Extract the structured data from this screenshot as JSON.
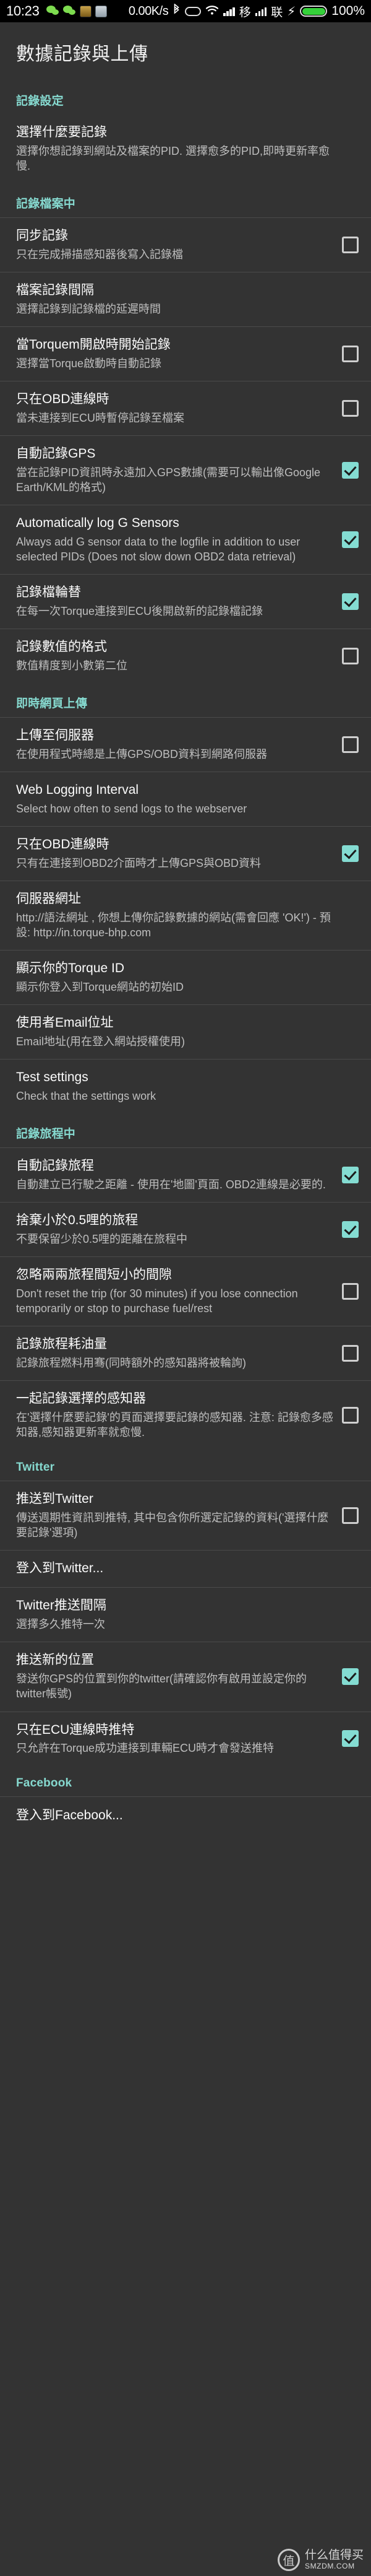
{
  "status_bar": {
    "time": "10:23",
    "net_speed": "0.00K/s",
    "mobile_label": "移",
    "carrier_label": "联",
    "battery_percent": "100%",
    "icons": [
      "wechat-icon",
      "wechat-icon",
      "app-icon",
      "app-icon",
      "bluetooth-icon",
      "vibrate-icon",
      "wifi-icon",
      "signal-bars-icon",
      "signal-bars-icon",
      "charging-bolt-icon",
      "battery-icon"
    ]
  },
  "page": {
    "title": "數據記錄與上傳"
  },
  "sections": [
    {
      "header": "記錄設定",
      "rows": [
        {
          "title": "選擇什麼要記錄",
          "summary": "選擇你想記錄到網站及檔案的PID. 選擇愈多的PID,即時更新率愈慢.",
          "checkbox": "none",
          "name": "row-select-what-to-log"
        }
      ]
    },
    {
      "header": "記錄檔案中",
      "rows": [
        {
          "title": "同步記錄",
          "summary": "只在完成掃描感知器後寫入記錄檔",
          "checkbox": "off",
          "name": "row-sync-logging"
        },
        {
          "title": "檔案記錄間隔",
          "summary": "選擇記錄到記錄檔的延遲時間",
          "checkbox": "none",
          "name": "row-file-logging-interval"
        },
        {
          "title": "當Torquem開啟時開始記錄",
          "summary": "選擇當Torque啟動時自動記錄",
          "checkbox": "off",
          "name": "row-start-logging-on-launch"
        },
        {
          "title": "只在OBD連線時",
          "summary": "當未連接到ECU時暫停記錄至檔案",
          "checkbox": "off",
          "name": "row-only-when-obd-connected-file"
        },
        {
          "title": "自動記錄GPS",
          "summary": "當在記錄PID資訊時永遠加入GPS數據(需要可以輸出像Google Earth/KML的格式)",
          "checkbox": "on",
          "name": "row-auto-log-gps"
        },
        {
          "title": "Automatically log G Sensors",
          "summary": "Always add G sensor data to the logfile in addition to user selected PIDs (Does not slow down OBD2 data retrieval)",
          "checkbox": "on",
          "name": "row-auto-log-g-sensors"
        },
        {
          "title": "記錄檔輪替",
          "summary": "在每一次Torque連接到ECU後開啟新的記錄檔記錄",
          "checkbox": "on",
          "name": "row-logfile-rotation"
        },
        {
          "title": "記錄數值的格式",
          "summary": "數值精度到小數第二位",
          "checkbox": "off",
          "name": "row-log-value-format"
        }
      ]
    },
    {
      "header": "即時網頁上傳",
      "rows": [
        {
          "title": "上傳至伺服器",
          "summary": "在使用程式時總是上傳GPS/OBD資料到網路伺服器",
          "checkbox": "off",
          "name": "row-upload-to-server"
        },
        {
          "title": "Web Logging Interval",
          "summary": "Select how often to send logs to the webserver",
          "checkbox": "none",
          "name": "row-web-logging-interval"
        },
        {
          "title": "只在OBD連線時",
          "summary": "只有在連接到OBD2介面時才上傳GPS與OBD資料",
          "checkbox": "on",
          "name": "row-only-when-obd-connected-web"
        },
        {
          "title": "伺服器網址",
          "summary": "http://語法網址 , 你想上傳你記錄數據的網站(需會回應 'OK!') - 預設: http://in.torque-bhp.com",
          "checkbox": "none",
          "name": "row-server-url"
        },
        {
          "title": "顯示你的Torque ID",
          "summary": "顯示你登入到Torque網站的初始ID",
          "checkbox": "none",
          "name": "row-show-torque-id"
        },
        {
          "title": "使用者Email位址",
          "summary": "Email地址(用在登入網站授權使用)",
          "checkbox": "none",
          "name": "row-user-email-address"
        },
        {
          "title": "Test settings",
          "summary": "Check that the settings work",
          "checkbox": "none",
          "name": "row-test-settings"
        }
      ]
    },
    {
      "header": "記錄旅程中",
      "rows": [
        {
          "title": "自動記錄旅程",
          "summary": "自動建立已行駛之距離 - 使用在'地圖'頁面. OBD2連線是必要的.",
          "checkbox": "on",
          "name": "row-auto-log-trips"
        },
        {
          "title": "捨棄小於0.5哩的旅程",
          "summary": "不要保留少於0.5哩的距離在旅程中",
          "checkbox": "on",
          "name": "row-discard-short-trips"
        },
        {
          "title": "忽略兩兩旅程間短小的間隙",
          "summary": "Don't reset the trip (for 30 minutes) if you lose connection temporarily or stop to purchase fuel/rest",
          "checkbox": "off",
          "name": "row-ignore-short-gaps"
        },
        {
          "title": "記錄旅程耗油量",
          "summary": "記錄旅程燃料用骞(同時額外的感知器將被輪詢)",
          "checkbox": "off",
          "name": "row-log-trip-fuel"
        },
        {
          "title": "一起記錄選擇的感知器",
          "summary": "在'選擇什麼要記錄'的頁面選擇要記錄的感知器. 注意: 記錄愈多感知器,感知器更新率就愈慢.",
          "checkbox": "off",
          "name": "row-log-selected-sensors"
        }
      ]
    },
    {
      "header": "Twitter",
      "rows": [
        {
          "title": "推送到Twitter",
          "summary": "傳送週期性資訊到推特, 其中包含你所選定記錄的資料('選擇什麼要記錄'選項)",
          "checkbox": "off",
          "name": "row-tweet-to-twitter"
        },
        {
          "title": "登入到Twitter...",
          "summary": "",
          "checkbox": "none",
          "name": "row-login-to-twitter"
        },
        {
          "title": "Twitter推送間隔",
          "summary": "選擇多久推特一次",
          "checkbox": "none",
          "name": "row-twitter-interval"
        },
        {
          "title": "推送新的位置",
          "summary": "發送你GPS的位置到你的twitter(請確認你有啟用並設定你的twitter帳號)",
          "checkbox": "on",
          "name": "row-tweet-new-location"
        },
        {
          "title": "只在ECU連線時推特",
          "summary": "只允許在Torque成功連接到車輛ECU時才會發送推特",
          "checkbox": "on",
          "name": "row-tweet-only-when-ecu-connected"
        }
      ]
    },
    {
      "header": "Facebook",
      "rows": [
        {
          "title": "登入到Facebook...",
          "summary": "",
          "checkbox": "none",
          "name": "row-login-to-facebook"
        }
      ]
    }
  ],
  "watermark": {
    "glyph": "值",
    "line1": "什么值得买",
    "line2": "SMZDM.COM"
  },
  "colors": {
    "background": "#333333",
    "section_header": "#86d9cf",
    "checkbox_on": "#84dcd2",
    "divider": "#4a4a4a"
  }
}
